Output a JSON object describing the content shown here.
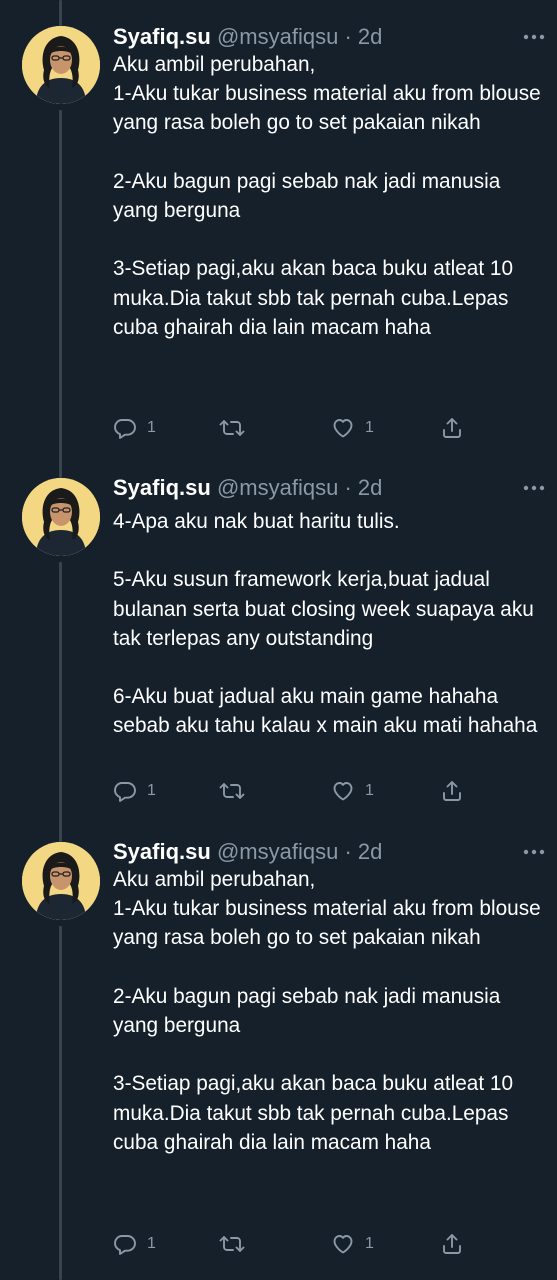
{
  "tweets": [
    {
      "name": "Syafiq.su",
      "handle": "@msyafiqsu",
      "separator": "·",
      "time": "2d",
      "text": "Aku ambil perubahan,\n1-Aku tukar business material aku from blouse yang rasa boleh go to set pakaian nikah\n\n2-Aku bagun pagi sebab nak jadi manusia yang berguna\n\n3-Setiap pagi,aku akan baca buku atleat 10 muka.Dia takut sbb tak pernah cuba.Lepas cuba ghairah dia lain macam haha",
      "replies": "1",
      "likes": "1"
    },
    {
      "name": "Syafiq.su",
      "handle": "@msyafiqsu",
      "separator": "·",
      "time": "2d",
      "text": "4-Apa aku nak buat haritu tulis.\n\n5-Aku susun framework kerja,buat jadual bulanan serta buat closing week suapaya aku tak terlepas any outstanding\n\n6-Aku buat jadual aku main game hahaha sebab aku tahu kalau x main aku mati hahaha",
      "replies": "1",
      "likes": "1"
    },
    {
      "name": "Syafiq.su",
      "handle": "@msyafiqsu",
      "separator": "·",
      "time": "2d",
      "text": "Aku ambil perubahan,\n1-Aku tukar business material aku from blouse yang rasa boleh go to set pakaian nikah\n\n2-Aku bagun pagi sebab nak jadi manusia yang berguna\n\n3-Setiap pagi,aku akan baca buku atleat 10 muka.Dia takut sbb tak pernah cuba.Lepas cuba ghairah dia lain macam haha",
      "replies": "1",
      "likes": "1"
    }
  ],
  "icons": {
    "reply": "reply-icon",
    "retweet": "retweet-icon",
    "like": "like-icon",
    "share": "share-icon",
    "more": "more-icon"
  },
  "colors": {
    "background": "#15202b",
    "primary_text": "#ffffff",
    "secondary_text": "#8b98a5",
    "thread_line": "#38444d",
    "avatar_bg": "#f4d783"
  }
}
